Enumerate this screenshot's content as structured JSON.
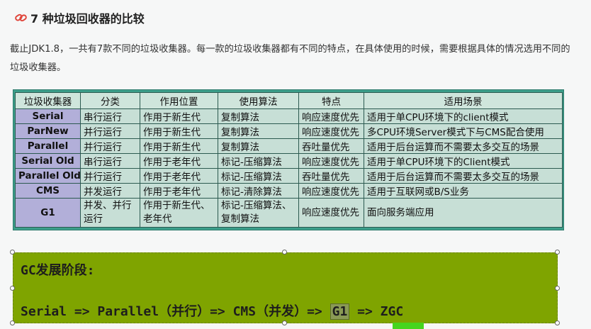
{
  "heading": {
    "icon": "link-icon",
    "title": "7 种垃圾回收器的比较"
  },
  "paragraph": "截止JDK1.8，一共有7款不同的垃圾收集器。每一款的垃圾收集器都有不同的特点，在具体使用的时候，需要根据具体的情况选用不同的垃圾收集器。",
  "table": {
    "headers": [
      "垃圾收集器",
      "分类",
      "作用位置",
      "使用算法",
      "特点",
      "适用场景"
    ],
    "rows": [
      [
        "Serial",
        "串行运行",
        "作用于新生代",
        "复制算法",
        "响应速度优先",
        "适用于单CPU环境下的client模式"
      ],
      [
        "ParNew",
        "并行运行",
        "作用于新生代",
        "复制算法",
        "响应速度优先",
        "多CPU环境Server模式下与CMS配合使用"
      ],
      [
        "Parallel",
        "并行运行",
        "作用于新生代",
        "复制算法",
        "吞吐量优先",
        "适用于后台运算而不需要太多交互的场景"
      ],
      [
        "Serial Old",
        "串行运行",
        "作用于老年代",
        "标记-压缩算法",
        "响应速度优先",
        "适用于单CPU环境下的Client模式"
      ],
      [
        "Parallel Old",
        "并行运行",
        "作用于老年代",
        "标记-压缩算法",
        "吞吐量优先",
        "适用于后台运算而不需要太多交互的场景"
      ],
      [
        "CMS",
        "并发运行",
        "作用于老年代",
        "标记-清除算法",
        "响应速度优先",
        "适用于互联网或B/S业务"
      ],
      [
        "G1",
        "并发、并行运行",
        "作用于新生代、老年代",
        "标记-压缩算法、复制算法",
        "响应速度优先",
        "面向服务端应用"
      ]
    ]
  },
  "box": {
    "line1": "GC发展阶段:",
    "line2_prefix": "Serial => Parallel（并行）=> CMS（并发）=> ",
    "line2_highlight": "G1",
    "line2_suffix": " => ZGC"
  },
  "colors": {
    "table_border": "#3c9e8a",
    "name_cell": "#b2afd9",
    "cell": "#c7dfd6",
    "box_bg": "#7fa400",
    "underline": "#46d51e"
  }
}
